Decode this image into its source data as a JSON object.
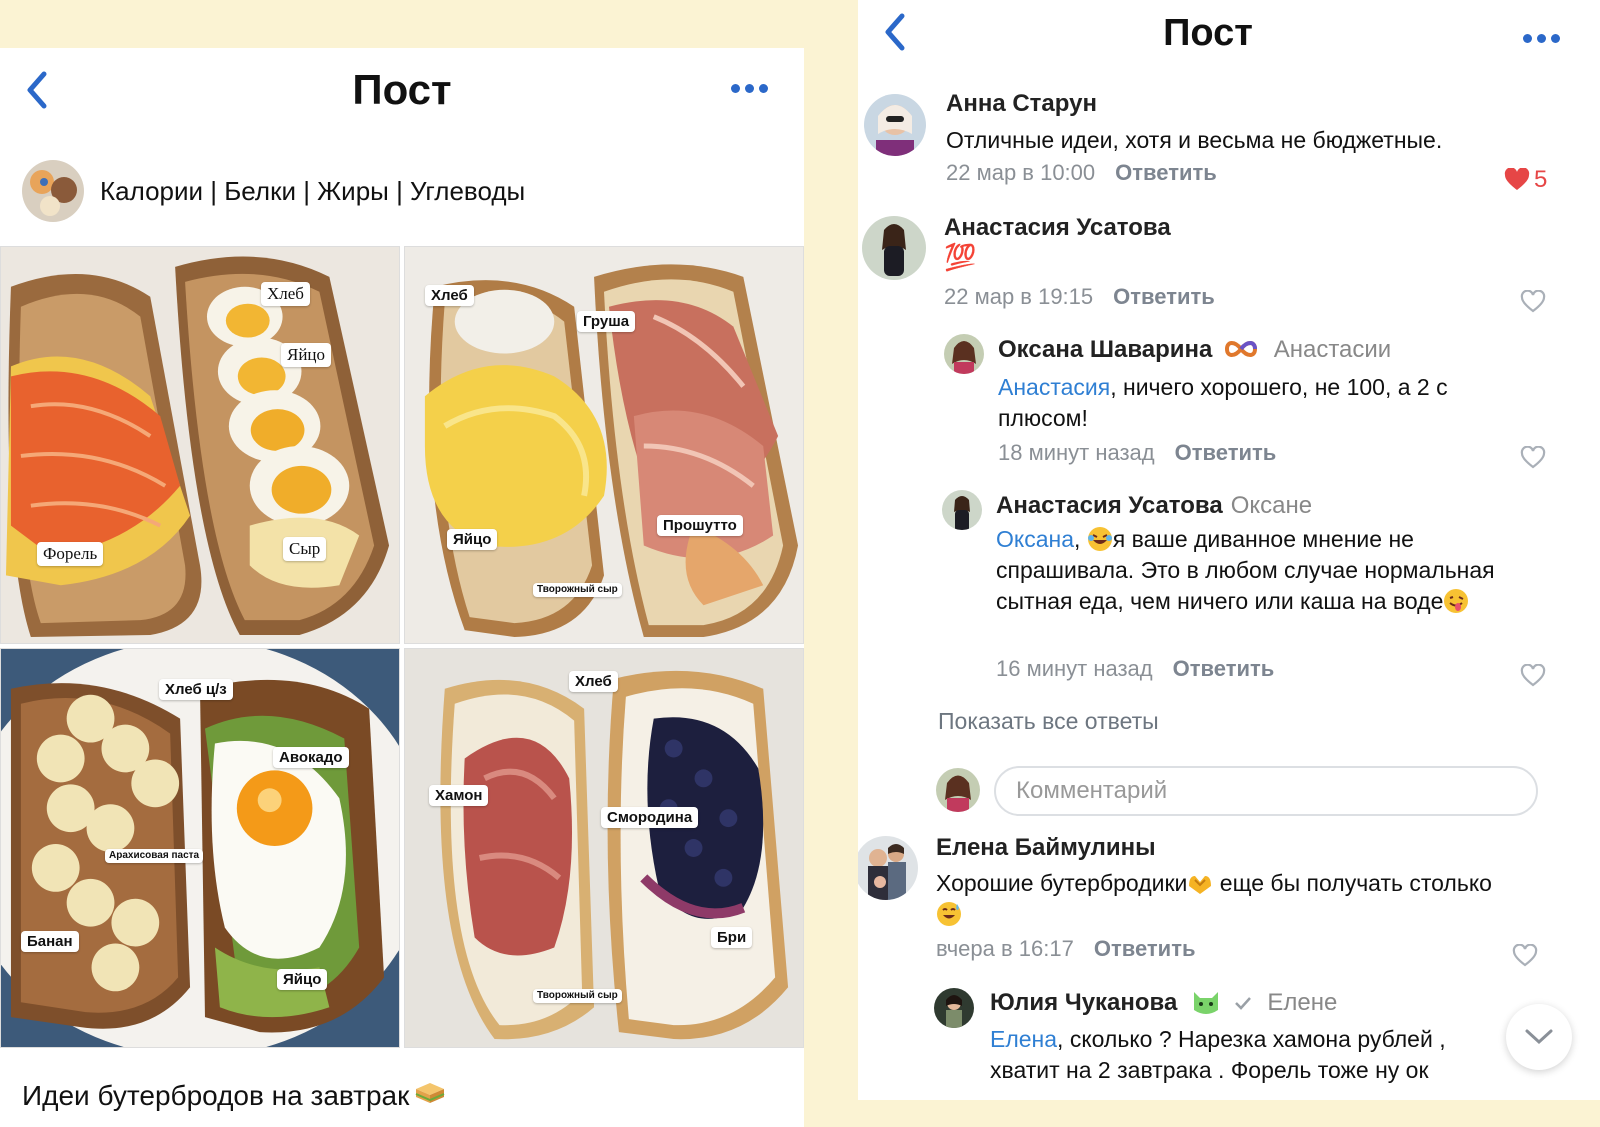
{
  "left": {
    "title": "Пост",
    "group_name": "Калории | Белки | Жиры | Углеводы",
    "tiles": [
      {
        "tags": [
          "Хлеб",
          "Яйцо",
          "Форель",
          "Сыр"
        ]
      },
      {
        "tags": [
          "Хлеб",
          "Груша",
          "Яйцо",
          "Прошутто",
          "Творожный сыр"
        ]
      },
      {
        "tags": [
          "Хлеб ц/з",
          "Авокадо",
          "Арахисовая паста",
          "Банан",
          "Яйцо"
        ]
      },
      {
        "tags": [
          "Хлеб",
          "Хамон",
          "Смородина",
          "Бри",
          "Творожный сыр"
        ]
      }
    ],
    "caption": "Идеи бутербродов на завтрак"
  },
  "right": {
    "title": "Пост",
    "comments": [
      {
        "name": "Анна Старун",
        "text": "Отличные идеи, хотя и весьма не бюджетные.",
        "time": "22 мар в 10:00",
        "reply": "Ответить",
        "likes": "5"
      },
      {
        "name": "Анастасия Усатова",
        "text": "💯",
        "time": "22 мар в 19:15",
        "reply": "Ответить"
      },
      {
        "name": "Оксана Шаварина",
        "reply_to": "Анастасии",
        "mention": "Анастасия",
        "text": ", ничего хорошего, не 100, а 2 с плюсом!",
        "time": "18 минут назад",
        "reply": "Ответить"
      },
      {
        "name": "Анастасия Усатова",
        "reply_to": "Оксане",
        "mention": "Оксана",
        "text_a": ", ",
        "text_b": "я ваше диванное мнение не спрашивала. Это в любом случае нормальная сытная еда, чем ничего или каша на воде",
        "time": "16 минут назад",
        "reply": "Ответить"
      },
      {
        "name": "Елена Баймулины",
        "text_a": "Хорошие бутербродики",
        "text_b": " еще бы получать столько ",
        "time": "вчера в 16:17",
        "reply": "Ответить"
      },
      {
        "name": "Юлия Чуканова",
        "reply_to": "Елене",
        "mention": "Елена",
        "text": ", сколько ? Нарезка хамона рублей , хватит на 2 завтрака . Форель тоже ну ок"
      }
    ],
    "show_all": "Показать все ответы",
    "comment_placeholder": "Комментарий"
  },
  "colors": {
    "accent": "#2f7fd3",
    "like": "#e64646",
    "background": "#fbf3d3"
  }
}
